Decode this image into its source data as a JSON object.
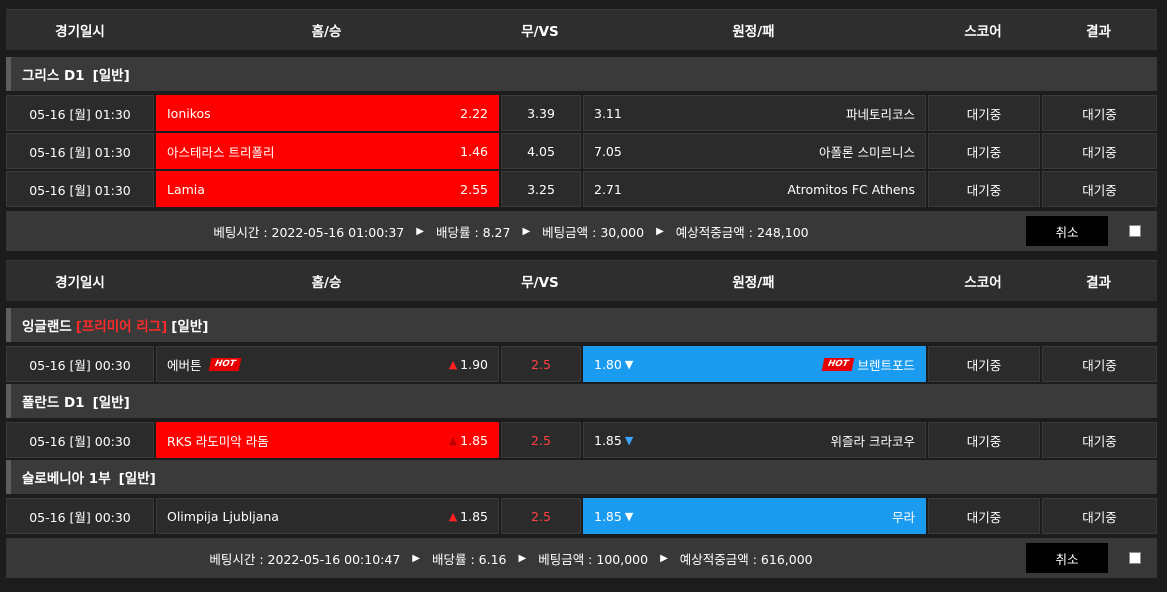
{
  "headers": {
    "time": "경기일시",
    "home": "홈/승",
    "draw": "무/VS",
    "away": "원정/패",
    "score": "스코어",
    "result": "결과"
  },
  "slips": [
    {
      "leagues": [
        {
          "name_pre": "그리스 D1",
          "name_highlight": "",
          "name_post": "[일반]",
          "matches": [
            {
              "time": "05-16 [월] 01:30",
              "home": "Ionikos",
              "home_odds": "2.22",
              "draw_odds": "3.39",
              "away": "파네토리코스",
              "away_odds": "3.11",
              "score": "대기중",
              "result": "대기중",
              "selected": "home"
            },
            {
              "time": "05-16 [월] 01:30",
              "home": "아스테라스 트리폴리",
              "home_odds": "1.46",
              "draw_odds": "4.05",
              "away": "아폴론 스미르니스",
              "away_odds": "7.05",
              "score": "대기중",
              "result": "대기중",
              "selected": "home"
            },
            {
              "time": "05-16 [월] 01:30",
              "home": "Lamia",
              "home_odds": "2.55",
              "draw_odds": "3.25",
              "away": "Atromitos FC Athens",
              "away_odds": "2.71",
              "score": "대기중",
              "result": "대기중",
              "selected": "home"
            }
          ]
        }
      ],
      "footer": {
        "bet_time": "베팅시간 : 2022-05-16 01:00:37",
        "odds": "배당률 : 8.27",
        "amount": "베팅금액 : 30,000",
        "expected": "예상적중금액 : 248,100",
        "cancel": "취소"
      }
    },
    {
      "leagues": [
        {
          "name_pre": "잉글랜드",
          "name_highlight": "[프리미어 리그]",
          "name_post": "[일반]",
          "matches": [
            {
              "time": "05-16 [월] 00:30",
              "home": "에버튼",
              "home_hot": "HOT",
              "home_odds": "1.90",
              "draw_odds": "2.5",
              "away": "브렌트포드",
              "away_hot": "HOT",
              "away_odds": "1.80",
              "score": "대기중",
              "result": "대기중",
              "selected": "away"
            }
          ]
        },
        {
          "name_pre": "폴란드 D1",
          "name_highlight": "",
          "name_post": "[일반]",
          "matches": [
            {
              "time": "05-16 [월] 00:30",
              "home": "RKS 라도미악 라돔",
              "home_odds": "1.85",
              "draw_odds": "2.5",
              "away": "위즐라 크라코우",
              "away_odds": "1.85",
              "score": "대기중",
              "result": "대기중",
              "selected": "home"
            }
          ]
        },
        {
          "name_pre": "슬로베니아 1부",
          "name_highlight": "",
          "name_post": "[일반]",
          "matches": [
            {
              "time": "05-16 [월] 00:30",
              "home": "Olimpija Ljubljana",
              "home_odds": "1.85",
              "draw_odds": "2.5",
              "away": "무라",
              "away_odds": "1.85",
              "score": "대기중",
              "result": "대기중",
              "selected": "away"
            }
          ]
        }
      ],
      "footer": {
        "bet_time": "베팅시간 : 2022-05-16 00:10:47",
        "odds": "배당률 : 6.16",
        "amount": "베팅금액 : 100,000",
        "expected": "예상적중금액 : 616,000",
        "cancel": "취소"
      }
    }
  ],
  "colors": {
    "selected_home": "#ff0000",
    "selected_away": "#1a9bf0",
    "highlight_league": "#ff2a2a",
    "handicap_draw": "#ff4040"
  }
}
